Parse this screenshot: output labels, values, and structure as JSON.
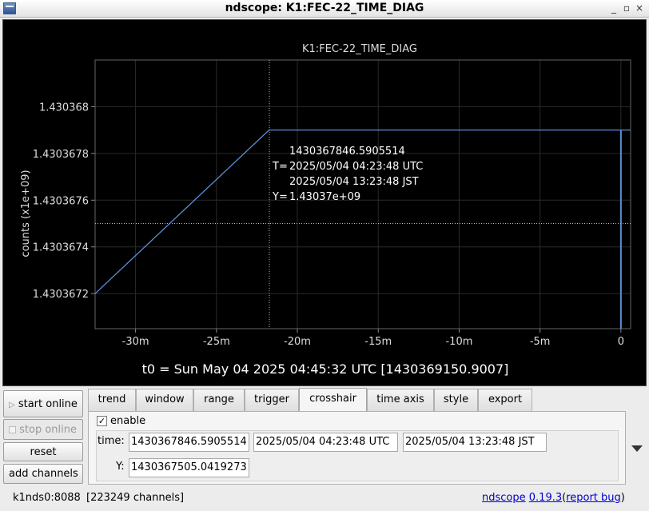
{
  "window": {
    "title": "ndscope: K1:FEC-22_TIME_DIAG"
  },
  "plot": {
    "title": "K1:FEC-22_TIME_DIAG",
    "ylabel": "counts (x1e+09)",
    "t0_label": "t0 = Sun May 04 2025 04:45:32 UTC [1430369150.9007]",
    "crosshair_text": [
      "1430367846.5905514",
      "T=",
      "2025/05/04 04:23:48 UTC",
      "2025/05/04 13:23:48 JST",
      "Y=",
      "1.43037e+09"
    ]
  },
  "chart_data": {
    "type": "line",
    "title": "K1:FEC-22_TIME_DIAG",
    "xlabel": "",
    "ylabel": "counts (x1e+09)",
    "x_unit": "minutes relative to t0",
    "xlim": [
      -32.5,
      0.6
    ],
    "ylim": [
      1.43036705,
      1.4303682
    ],
    "x_ticks": [
      -30,
      -25,
      -20,
      -15,
      -10,
      -5,
      0
    ],
    "x_tick_labels": [
      "-30m",
      "-25m",
      "-20m",
      "-15m",
      "-10m",
      "-5m",
      "0"
    ],
    "y_ticks": [
      1.4303672,
      1.4303674,
      1.4303676,
      1.4303678,
      1.430368
    ],
    "y_tick_labels": [
      "1.4303672",
      "1.4303674",
      "1.4303676",
      "1.4303678",
      "1.430368"
    ],
    "series": [
      {
        "x": [
          -32.5,
          -21.75,
          0.6
        ],
        "y": [
          1.4303672,
          1.4303679,
          1.4303679
        ],
        "color": "#5a8fd8"
      }
    ],
    "vertical_drop": {
      "x": 0,
      "y_from": 1.4303679,
      "y_to": 1.43036705
    },
    "crosshair": {
      "x": -21.73,
      "y": 1.4303675
    },
    "grid": true
  },
  "controls": {
    "start_online": "start online",
    "stop_online": "stop online",
    "reset": "reset",
    "add_channels": "add channels",
    "start_icon": "play-icon",
    "stop_icon": "stop-checkbox-icon"
  },
  "tabs": [
    "trend",
    "window",
    "range",
    "trigger",
    "crosshair",
    "time axis",
    "style",
    "export"
  ],
  "active_tab": "crosshair",
  "crosshair_panel": {
    "enable_label": "enable",
    "enable_check": "✓",
    "time_label": "time:",
    "time_gps": "1430367846.5905514",
    "time_utc": "2025/05/04 04:23:48 UTC",
    "time_jst": "2025/05/04 13:23:48 JST",
    "y_label": "Y:",
    "y_value": "1430367505.0419273"
  },
  "status": {
    "server": "k1nds0:8088",
    "channels": "[223249 channels]",
    "app_link": "ndscope",
    "version_link": "0.19.3",
    "paren_open": "(",
    "report_link": "report bug",
    "paren_close": ")"
  }
}
